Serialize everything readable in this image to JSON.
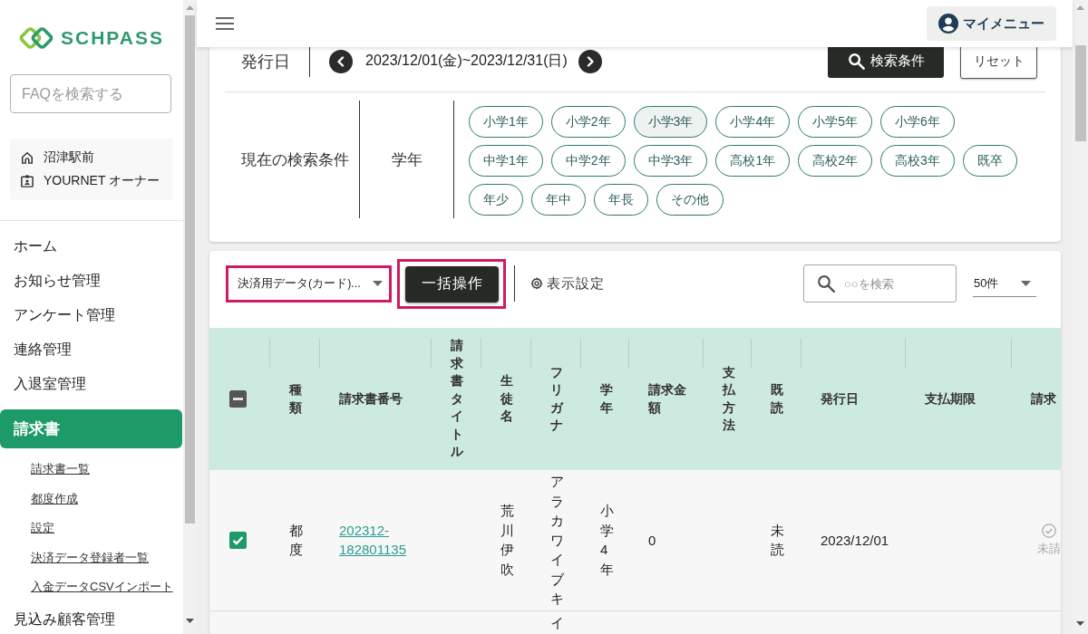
{
  "sidebar": {
    "logo": "SCHPASS",
    "faq_search": {
      "placeholder": "FAQを検索する"
    },
    "account": {
      "school": "沼津駅前",
      "user": "YOURNET オーナー"
    },
    "menu": [
      {
        "label": "ホーム",
        "selected": false
      },
      {
        "label": "お知らせ管理",
        "selected": false
      },
      {
        "label": "アンケート管理",
        "selected": false
      },
      {
        "label": "連絡管理",
        "selected": false
      },
      {
        "label": "入退室管理",
        "selected": false
      },
      {
        "label": "請求書",
        "selected": true,
        "children": [
          {
            "label": "請求書一覧",
            "selected": false
          },
          {
            "label": "都度作成",
            "selected": false
          },
          {
            "label": "設定",
            "selected": false
          },
          {
            "label": "決済データ登録者一覧",
            "selected": false
          },
          {
            "label": "入金データCSVインポート",
            "selected": false
          }
        ]
      },
      {
        "label": "見込み顧客管理",
        "selected": false
      }
    ]
  },
  "topbar": {
    "my_menu": "マイメニュー"
  },
  "filter": {
    "date_label": "発行日",
    "date_range": "2023/12/01(金)~2023/12/31(日)",
    "search_button": "検索条件",
    "reset_button": "リセット",
    "conditions_label": "現在の検索条件",
    "grade_label": "学年",
    "grades": [
      {
        "label": "小学1年",
        "hovered": false
      },
      {
        "label": "小学2年",
        "hovered": false
      },
      {
        "label": "小学3年",
        "hovered": true
      },
      {
        "label": "小学4年",
        "hovered": false
      },
      {
        "label": "小学5年",
        "hovered": false
      },
      {
        "label": "小学6年",
        "hovered": false
      },
      {
        "label": "中学1年",
        "hovered": false
      },
      {
        "label": "中学2年",
        "hovered": false
      },
      {
        "label": "中学3年",
        "hovered": false
      },
      {
        "label": "高校1年",
        "hovered": false
      },
      {
        "label": "高校2年",
        "hovered": false
      },
      {
        "label": "高校3年",
        "hovered": false
      },
      {
        "label": "既卒",
        "hovered": false
      },
      {
        "label": "年少",
        "hovered": false
      },
      {
        "label": "年中",
        "hovered": false
      },
      {
        "label": "年長",
        "hovered": false
      },
      {
        "label": "その他",
        "hovered": false
      }
    ]
  },
  "toolbar": {
    "data_select": {
      "value": "決済用データ(カード)...",
      "highlighted": true
    },
    "bulk_button": {
      "label": "一括操作",
      "highlighted": true
    },
    "display_settings": "表示設定",
    "search": {
      "placeholder": "○○を検索"
    },
    "per_page": "50件"
  },
  "table": {
    "header_checkbox": {
      "indeterminate": true
    },
    "columns": [
      "種類",
      "請求書番号",
      "請求書タイトル",
      "生徒名",
      "フリガナ",
      "学年",
      "請求金額",
      "支払方法",
      "既読",
      "発行日",
      "支払期限",
      "請求"
    ],
    "rows": [
      {
        "checked": true,
        "cells": [
          {
            "kind": "text",
            "text": "都度"
          },
          {
            "kind": "link",
            "text": "202312-182801135"
          },
          {
            "kind": "empty"
          },
          {
            "kind": "text",
            "text": "荒川伊吹"
          },
          {
            "kind": "text",
            "text": "アラカワイブキ"
          },
          {
            "kind": "text",
            "text": "小学4年"
          },
          {
            "kind": "text",
            "text": "0"
          },
          {
            "kind": "empty"
          },
          {
            "kind": "text",
            "text": "未読"
          },
          {
            "kind": "text",
            "text": "2023/12/01"
          },
          {
            "kind": "empty"
          },
          {
            "kind": "status",
            "text": "未請"
          }
        ]
      },
      {
        "cells": [
          {
            "kind": "empty"
          },
          {
            "kind": "empty"
          },
          {
            "kind": "empty"
          },
          {
            "kind": "empty"
          },
          {
            "kind": "text",
            "text": "イ"
          },
          {
            "kind": "empty"
          },
          {
            "kind": "empty"
          },
          {
            "kind": "empty"
          },
          {
            "kind": "empty"
          },
          {
            "kind": "empty"
          },
          {
            "kind": "empty"
          },
          {
            "kind": "empty"
          }
        ]
      }
    ]
  }
}
